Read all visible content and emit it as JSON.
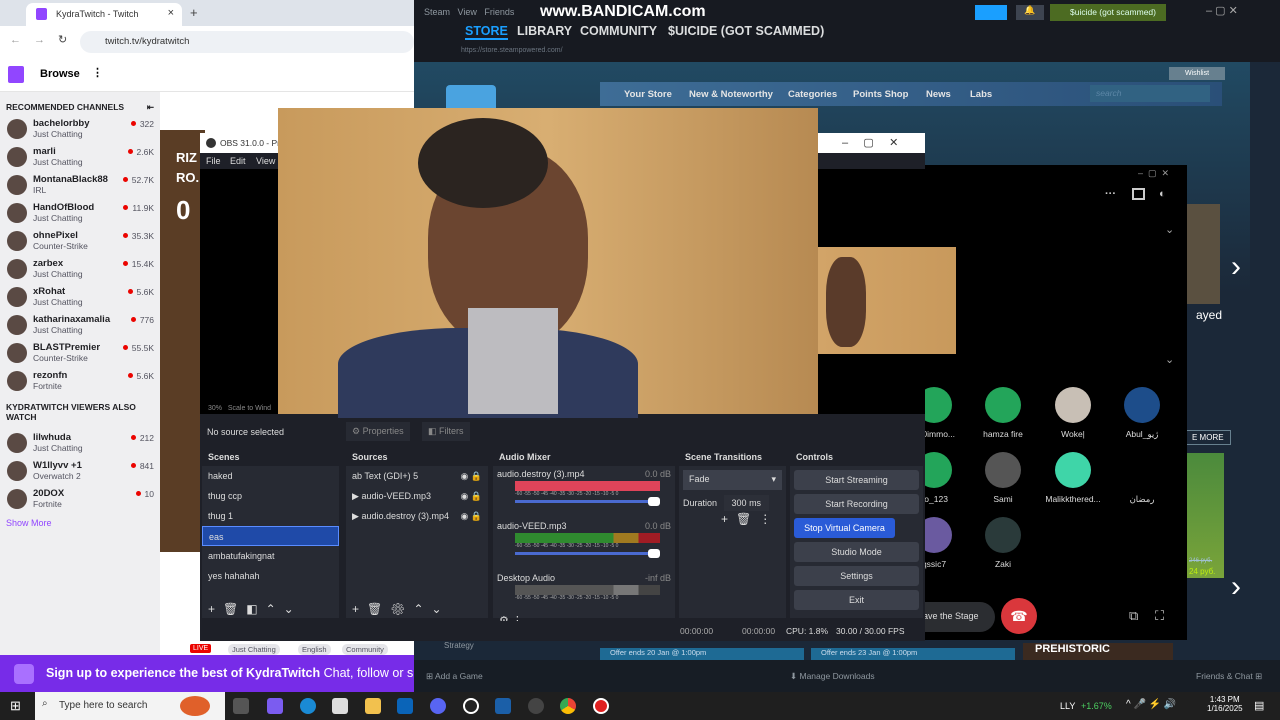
{
  "browser": {
    "tab_title": "KydraTwitch - Twitch",
    "url": "twitch.tv/kydratwitch"
  },
  "twitch": {
    "browse": "Browse",
    "recommended_header": "RECOMMENDED CHANNELS",
    "also_watch_header": "KYDRATWITCH VIEWERS ALSO WATCH",
    "show_more": "Show More",
    "recommended": [
      {
        "name": "bachelorbby",
        "game": "Just Chatting",
        "viewers": "322"
      },
      {
        "name": "marli",
        "game": "Just Chatting",
        "viewers": "2.6K"
      },
      {
        "name": "MontanaBlack88",
        "game": "IRL",
        "viewers": "52.7K"
      },
      {
        "name": "HandOfBlood",
        "game": "Just Chatting",
        "viewers": "11.9K"
      },
      {
        "name": "ohnePixel",
        "game": "Counter-Strike",
        "viewers": "35.3K"
      },
      {
        "name": "zarbex",
        "game": "Just Chatting",
        "viewers": "15.4K"
      },
      {
        "name": "xRohat",
        "game": "Just Chatting",
        "viewers": "5.6K"
      },
      {
        "name": "katharinaxamalia",
        "game": "Just Chatting",
        "viewers": "776"
      },
      {
        "name": "BLASTPremier",
        "game": "Counter-Strike",
        "viewers": "55.5K"
      },
      {
        "name": "rezonfn",
        "game": "Fortnite",
        "viewers": "5.6K"
      }
    ],
    "also_watch": [
      {
        "name": "lilwhuda",
        "game": "Just Chatting",
        "viewers": "212"
      },
      {
        "name": "W1llyvv +1",
        "game": "Overwatch 2",
        "viewers": "841"
      },
      {
        "name": "20DOX",
        "game": "Fortnite",
        "viewers": "10"
      }
    ],
    "video_text": [
      "RIZ",
      "RO.",
      "0"
    ],
    "live_badge": "LIVE",
    "stream_tags": [
      "Just Chatting",
      "English",
      "Community"
    ],
    "banner_text": "Sign up to experience the best of KydraTwitch",
    "banner_sub": "Chat, follow or s"
  },
  "steam": {
    "menu": [
      "Steam",
      "View",
      "Friends"
    ],
    "watermark": "www.BANDICAM.com",
    "user": "$uicide (got scammed)",
    "nav": [
      "STORE",
      "LIBRARY",
      "COMMUNITY",
      "$UICIDE (GOT SCAMMED)"
    ],
    "url": "https://store.steampowered.com/",
    "wishlist": "Wishlist",
    "store_nav": [
      "Your Store",
      "New & Noteworthy",
      "Categories",
      "Points Shop",
      "News",
      "Labs"
    ],
    "search_placeholder": "search",
    "offers": [
      "Offer ends 20 Jan @ 1:00pm",
      "Offer ends 23 Jan @ 1:00pm"
    ],
    "strategy": "Strategy",
    "prehistoric": "PREHISTORIC",
    "played": "ayed",
    "more": "E MORE",
    "price_old": "246 руб.",
    "price": "24 руб.",
    "footer": {
      "add_game": "Add a Game",
      "downloads": "Manage Downloads",
      "friends": "Friends & Chat"
    },
    "accent": "#1a9fff"
  },
  "obs": {
    "title": "OBS 31.0.0 - Prof",
    "menu": [
      "File",
      "Edit",
      "View"
    ],
    "zoom": "30%",
    "scale": "Scale to Wind",
    "no_source": "No source selected",
    "properties": "Properties",
    "filters": "Filters",
    "scenes_title": "Scenes",
    "scenes": [
      "haked",
      "thug ccp",
      "thug 1",
      "eas",
      "ambatufakingnat",
      "yes hahahah"
    ],
    "selected_scene": "eas",
    "sources_title": "Sources",
    "sources": [
      "Text (GDI+) 5",
      "audio-VEED.mp3",
      "audio.destroy (3).mp4"
    ],
    "mixer_title": "Audio Mixer",
    "mixer": [
      {
        "name": "audio.destroy (3).mp4",
        "db": "0.0 dB"
      },
      {
        "name": "audio-VEED.mp3",
        "db": "0.0 dB"
      },
      {
        "name": "Desktop Audio",
        "db": "-inf dB"
      }
    ],
    "meter_scale": "-60 -55 -50 -45 -40 -35 -30 -25 -20 -15 -10 -5 0",
    "transitions_title": "Scene Transitions",
    "transition": "Fade",
    "duration_label": "Duration",
    "duration": "300 ms",
    "controls_title": "Controls",
    "controls": [
      "Start Streaming",
      "Start Recording",
      "Stop Virtual Camera",
      "Studio Mode",
      "Settings",
      "Exit"
    ],
    "status": {
      "stream_time": "00:00:00",
      "rec_time": "00:00:00",
      "cpu": "CPU: 1.8%",
      "fps": "30.00 / 30.00 FPS"
    }
  },
  "discord": {
    "users": [
      {
        "name": "570immo..."
      },
      {
        "name": "hamza fire"
      },
      {
        "name": "Woke|"
      },
      {
        "name": "Abul_ژیو"
      },
      {
        "name": "zo_123"
      },
      {
        "name": "Sami"
      },
      {
        "name": "Malikkthered..."
      },
      {
        "name": "رمضان"
      },
      {
        "name": "qssic7"
      },
      {
        "name": "Zaki"
      }
    ],
    "leave": "ave the Stage"
  },
  "taskbar": {
    "search": "Type here to search",
    "stock": "LLY",
    "stock_change": "+1.67%",
    "time": "1:43 PM",
    "date": "1/16/2025"
  }
}
